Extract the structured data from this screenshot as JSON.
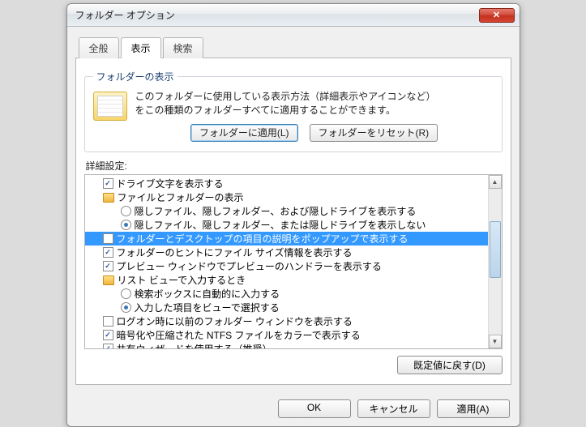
{
  "window": {
    "title": "フォルダー オプション"
  },
  "tabs": {
    "general": "全般",
    "view": "表示",
    "search": "検索"
  },
  "folderview": {
    "legend": "フォルダーの表示",
    "desc1": "このフォルダーに使用している表示方法（詳細表示やアイコンなど）",
    "desc2": "をこの種類のフォルダーすべてに適用することができます。",
    "apply": "フォルダーに適用(L)",
    "reset": "フォルダーをリセット(R)"
  },
  "advanced": {
    "label": "詳細設定:"
  },
  "tree": {
    "i0": "ドライブ文字を表示する",
    "i1": "ファイルとフォルダーの表示",
    "i2": "隠しファイル、隠しフォルダー、および隠しドライブを表示する",
    "i3": "隠しファイル、隠しフォルダー、または隠しドライブを表示しない",
    "i4": "フォルダーとデスクトップの項目の説明をポップアップで表示する",
    "i5": "フォルダーのヒントにファイル サイズ情報を表示する",
    "i6": "プレビュー ウィンドウでプレビューのハンドラーを表示する",
    "i7": "リスト ビューで入力するとき",
    "i8": "検索ボックスに自動的に入力する",
    "i9": "入力した項目をビューで選択する",
    "i10": "ログオン時に以前のフォルダー ウィンドウを表示する",
    "i11": "暗号化や圧縮された NTFS ファイルをカラーで表示する",
    "i12": "共有ウィザードを使用する（推奨）"
  },
  "restore": "既定値に戻す(D)",
  "buttons": {
    "ok": "OK",
    "cancel": "キャンセル",
    "apply": "適用(A)"
  }
}
